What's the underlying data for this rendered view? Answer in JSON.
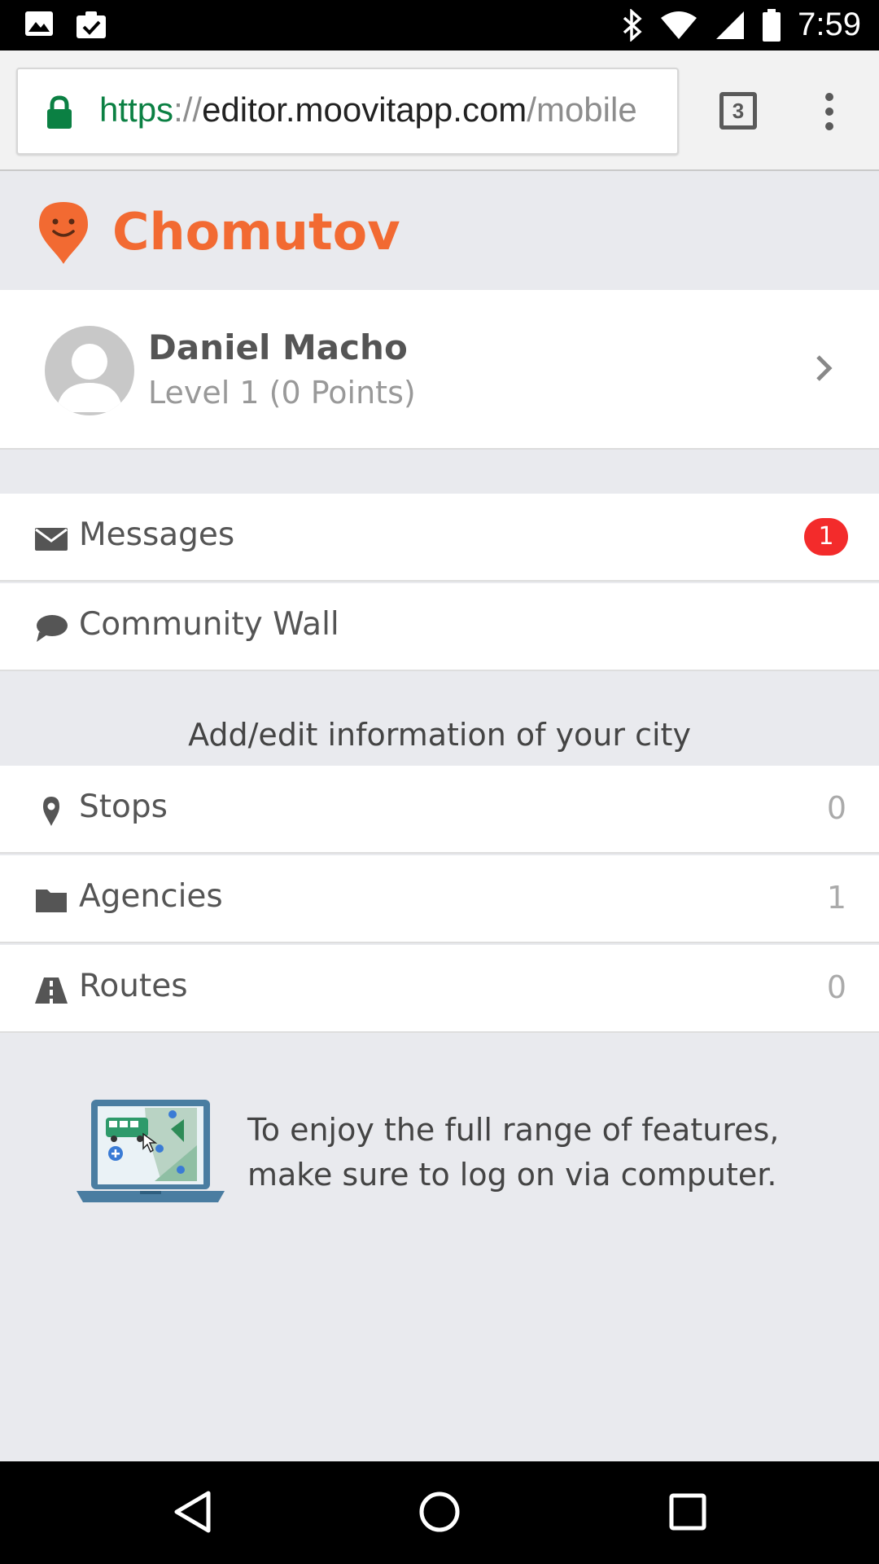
{
  "status_bar": {
    "time": "7:59",
    "icons": [
      "image-icon",
      "clipboard-check-icon",
      "bluetooth-icon",
      "wifi-icon",
      "signal-icon",
      "battery-icon"
    ]
  },
  "browser": {
    "url_scheme": "https",
    "url_separator": "://",
    "url_host": "editor.moovitapp.com",
    "url_path": "/mobile",
    "tab_count": "3",
    "scheme_color": "#0b8043"
  },
  "header": {
    "city": "Chomutov",
    "brand_color": "#f26a32"
  },
  "profile": {
    "name": "Daniel Macho",
    "level": "Level 1 (0 Points)"
  },
  "menu": {
    "messages": {
      "label": "Messages",
      "badge": "1"
    },
    "community": {
      "label": "Community Wall"
    }
  },
  "edit_section": {
    "title": "Add/edit information of your city",
    "stops": {
      "label": "Stops",
      "count": "0"
    },
    "agencies": {
      "label": "Agencies",
      "count": "1"
    },
    "routes": {
      "label": "Routes",
      "count": "0"
    }
  },
  "promo": {
    "text": "To enjoy the full range of features, make sure to log on via computer."
  },
  "nav_bar": {
    "icons": [
      "back-icon",
      "home-icon",
      "recents-icon"
    ]
  }
}
